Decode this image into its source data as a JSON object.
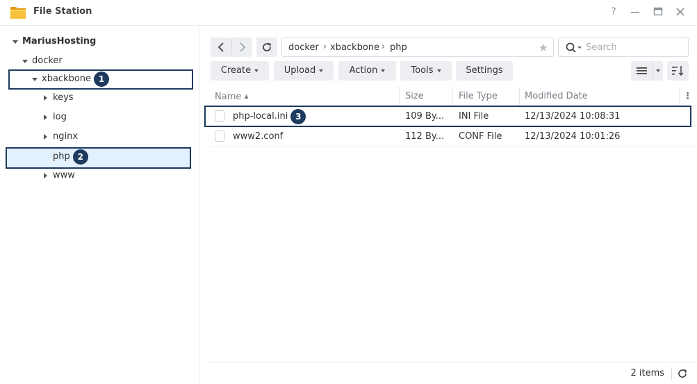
{
  "window": {
    "title": "File Station",
    "help": "?",
    "minimize": "–",
    "close": "✕"
  },
  "tree": {
    "root": "MariusHosting",
    "docker": "docker",
    "xbackbone": "xbackbone",
    "keys": "keys",
    "log": "log",
    "nginx": "nginx",
    "php": "php",
    "www": "www"
  },
  "badges": {
    "one": "1",
    "two": "2",
    "three": "3"
  },
  "path": {
    "seg1": "docker",
    "seg2": "xbackbone",
    "seg3": "php",
    "sep": "›"
  },
  "search": {
    "placeholder": "Search"
  },
  "toolbar": {
    "create": "Create",
    "upload": "Upload",
    "action": "Action",
    "tools": "Tools",
    "settings": "Settings"
  },
  "table": {
    "columns": {
      "name": "Name",
      "size": "Size",
      "type": "File Type",
      "modified": "Modified Date"
    },
    "rows": [
      {
        "name": "php-local.ini",
        "size": "109 By...",
        "type": "INI File",
        "modified": "12/13/2024 10:08:31"
      },
      {
        "name": "www2.conf",
        "size": "112 By...",
        "type": "CONF File",
        "modified": "12/13/2024 10:01:26"
      }
    ]
  },
  "footer": {
    "count": "2 items"
  },
  "colors": {
    "accent": "#1e3a5f",
    "selection": "#e3f0fd",
    "folder": "#f5b324"
  }
}
